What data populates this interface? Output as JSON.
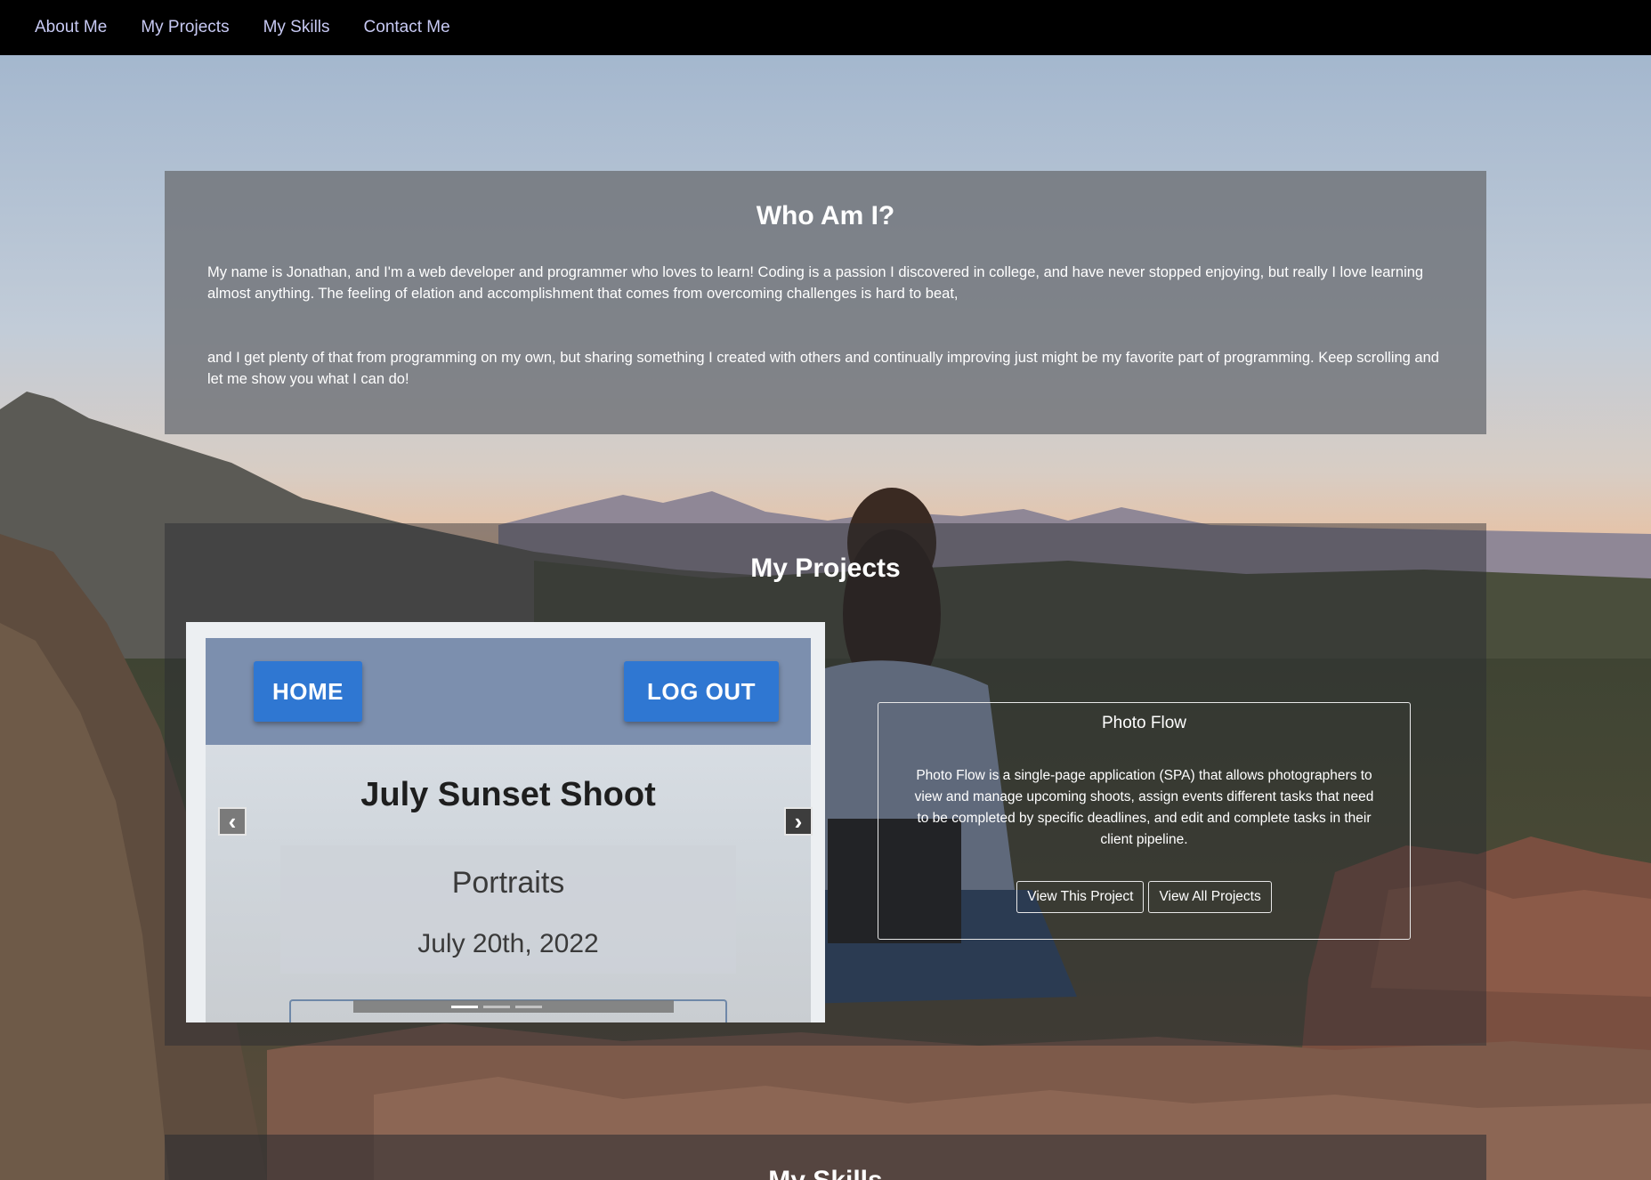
{
  "nav": {
    "items": [
      "About Me",
      "My Projects",
      "My Skills",
      "Contact Me"
    ]
  },
  "about": {
    "title": "Who Am I?",
    "paragraphs": [
      "My name is Jonathan, and I'm a web developer and programmer who loves to learn! Coding is a passion I discovered in college, and have never stopped enjoying, but really I love learning almost anything. The feeling of elation and accomplishment that comes from overcoming challenges is hard to beat,",
      "and I get plenty of that from programming on my own, but sharing something I created with others and continually improving just might be my favorite part of programming. Keep scrolling and let me show you what I can do!"
    ]
  },
  "projects": {
    "title": "My Projects",
    "carousel": {
      "prev_icon": "chevron-left-icon",
      "next_icon": "chevron-right-icon",
      "slide": {
        "home_label": "HOME",
        "logout_label": "LOG OUT",
        "shoot_title": "July Sunset Shoot",
        "category": "Portraits",
        "date": "July 20th, 2022"
      },
      "indicator_count": 3,
      "active_indicator": 0
    },
    "card": {
      "name": "Photo Flow",
      "description": "Photo Flow is a single-page application (SPA) that allows photographers to view and manage upcoming shoots, assign events different tasks that need to be completed by specific deadlines, and edit and complete tasks in their client pipeline.",
      "view_project_label": "View This Project",
      "view_all_label": "View All Projects"
    }
  },
  "skills": {
    "title": "My Skills"
  },
  "colors": {
    "nav_bg": "#000000",
    "nav_link": "#c7c9f3",
    "slide_button": "#2f77d2"
  }
}
